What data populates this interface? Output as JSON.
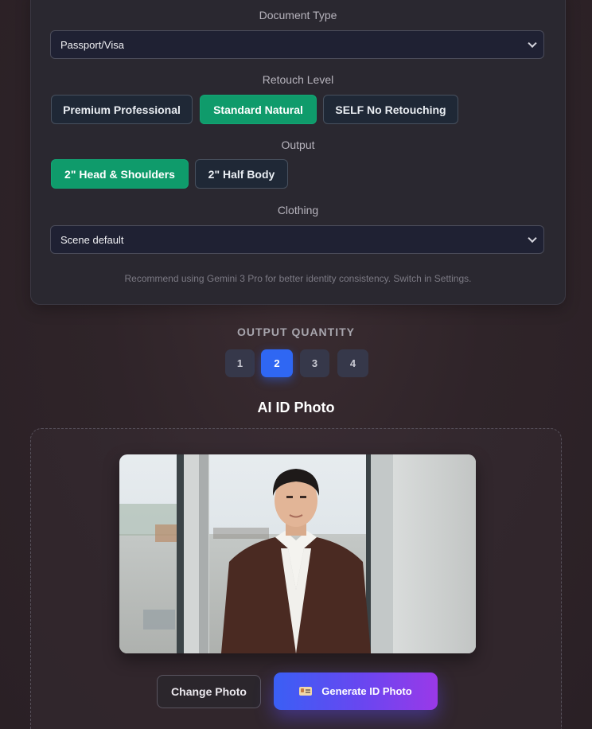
{
  "document_type": {
    "label": "Document Type",
    "value": "Passport/Visa"
  },
  "retouch": {
    "label": "Retouch Level",
    "options": [
      "Premium Professional",
      "Standard Natural",
      "SELF No Retouching"
    ],
    "selected": "Standard Natural"
  },
  "output": {
    "label": "Output",
    "options": [
      "2\" Head & Shoulders",
      "2\" Half Body"
    ],
    "selected": "2\" Head & Shoulders"
  },
  "clothing": {
    "label": "Clothing",
    "value": "Scene default"
  },
  "hint": "Recommend using Gemini 3 Pro for better identity consistency. Switch in Settings.",
  "quantity": {
    "label": "OUTPUT QUANTITY",
    "options": [
      "1",
      "2",
      "3",
      "4"
    ],
    "selected": "2"
  },
  "section_title": "AI ID Photo",
  "actions": {
    "change_photo": "Change Photo",
    "generate": "Generate ID Photo",
    "generate_icon": "id-card-icon"
  },
  "colors": {
    "accent_green": "#0f9b6b",
    "accent_blue": "#2f67f3",
    "gradient_start": "#3a5ff5",
    "gradient_end": "#9a39e8"
  }
}
